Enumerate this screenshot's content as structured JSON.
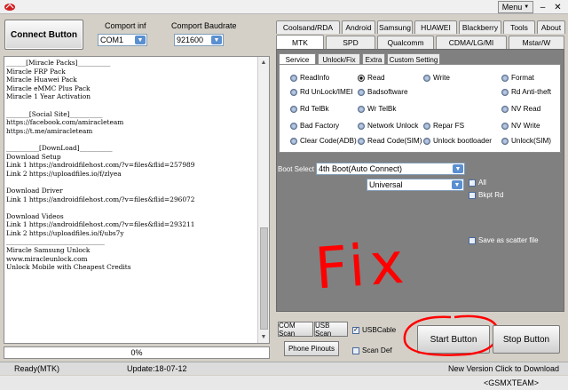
{
  "titlebar": {
    "menu_label": "Menu",
    "menu_arrow": "▼",
    "minimize": "–",
    "close": "✕"
  },
  "connect_button": "Connect Button",
  "port": {
    "label": "Comport inf",
    "value": "COM1"
  },
  "baud": {
    "label": "Comport Baudrate",
    "value": "921600"
  },
  "log_lines": "______[Miracle Packs]__________\nMiracle FRP Pack\nMiracle Huawei Pack\nMiracle eMMC Plus Pack\nMiracle 1 Year Activation\n\n_______[Social Site]__________\nhttps://facebook.com/amiracleteam\nhttps://t.me/amiracleteam\n\n__________[DownLoad]__________\nDownload Setup\nLink 1 https://androidfilehost.com/?v=files&flid=257989\nLink 2 https://uploadfiles.io/f/zlyea\n\nDownload Driver\nLink 1 https://androidfilehost.com/?v=files&flid=296072\n\nDownload Videos\nLink 1 https://androidfilehost.com/?v=files&flid=293211\nLink 2 https://uploadfiles.io/f/ubs7y\n______________________________\nMiracle Samsung Unlock\nwww.miracleunlock.com\nUnlock Mobile with Cheapest Credits",
  "progress": "0%",
  "tabs_row1": [
    "Coolsand/RDA",
    "Android",
    "Samsung",
    "HUAWEI",
    "Blackberry",
    "Tools",
    "About"
  ],
  "tabs_row2": [
    "MTK",
    "SPD",
    "Qualcomm",
    "CDMA/LG/MI",
    "Mstar/W"
  ],
  "subtabs": [
    "Service",
    "Unlock/Fix",
    "Extra",
    "Custom Setting"
  ],
  "radios": {
    "read_info": "ReadInfo",
    "read": "Read",
    "write": "Write",
    "format": "Format",
    "rd_unlock_imei": "Rd UnLock/IMEI",
    "badsoftware": "Badsoftware",
    "rd_anti_theft": "Rd Anti-theft",
    "rd_telbk": "Rd TelBk",
    "wr_telbk": "Wr TelBk",
    "nv_read": "NV Read",
    "bad_factory": "Bad Factory",
    "network_unlock": "Network Unlock",
    "repair_fs": "Repar FS",
    "nv_write": "NV Write",
    "clear_code_adb": "Clear Code(ADB)",
    "read_code_sim": "Read Code(SIM)",
    "unlock_bootloader": "Unlock bootloader",
    "unlock_sim": "Unlock(SIM)"
  },
  "boot_select": {
    "label": "Boot Select",
    "value": "4th Boot(Auto Connect)",
    "mode": "Universal"
  },
  "checks": {
    "all": "All",
    "bkpt_rd": "Bkpt Rd",
    "save_scatter": "Save as scatter file",
    "usb_cable": "USBCable",
    "scan_def": "Scan Def"
  },
  "annotation": "Fix",
  "buttons": {
    "com_scan": "COM Scan",
    "usb_scan": "USB Scan",
    "phone_pinouts": "Phone Pinouts",
    "start": "Start Button",
    "stop": "Stop Button"
  },
  "status": {
    "ready": "Ready(MTK)",
    "update": "Update:18-07-12",
    "new_version": "New Version Click to Download",
    "team": "<GSMXTEAM>"
  },
  "colors": {
    "panel_gray": "#808080",
    "annotation_red": "#ff0000"
  }
}
